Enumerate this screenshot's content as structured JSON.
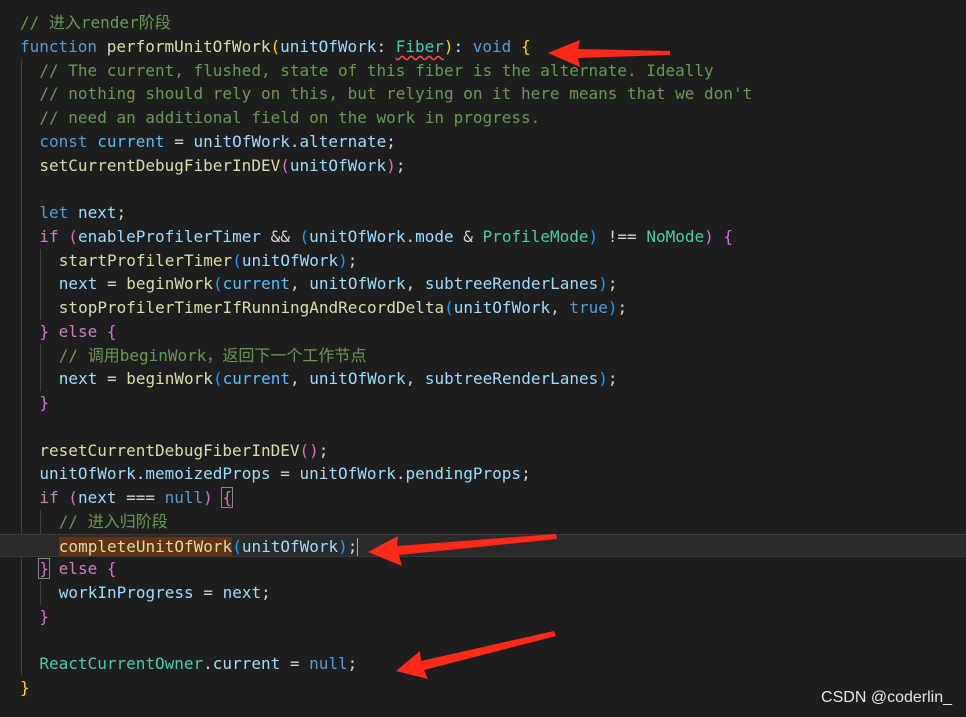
{
  "editor": {
    "lines": [
      {
        "indent": 0,
        "tokens": [
          {
            "t": "// 进入render阶段",
            "c": "com"
          }
        ]
      },
      {
        "indent": 0,
        "tokens": [
          {
            "t": "function",
            "c": "kw"
          },
          {
            "t": " ",
            "c": "pl"
          },
          {
            "t": "performUnitOfWork",
            "c": "fn"
          },
          {
            "t": "(",
            "c": "br1"
          },
          {
            "t": "unitOfWork",
            "c": "var"
          },
          {
            "t": ": ",
            "c": "pl"
          },
          {
            "t": "Fiber",
            "c": "ty",
            "squiggle": true
          },
          {
            "t": ")",
            "c": "br1"
          },
          {
            "t": ": ",
            "c": "pl"
          },
          {
            "t": "void",
            "c": "kw"
          },
          {
            "t": " ",
            "c": "pl"
          },
          {
            "t": "{",
            "c": "br1"
          }
        ]
      },
      {
        "indent": 1,
        "tokens": [
          {
            "t": "// The current, flushed, state of this fiber is the alternate. Ideally",
            "c": "com"
          }
        ]
      },
      {
        "indent": 1,
        "tokens": [
          {
            "t": "// nothing should rely on this, but relying on it here means that we don't",
            "c": "com"
          }
        ]
      },
      {
        "indent": 1,
        "tokens": [
          {
            "t": "// need an additional field on the work in progress.",
            "c": "com"
          }
        ]
      },
      {
        "indent": 1,
        "tokens": [
          {
            "t": "const",
            "c": "kw"
          },
          {
            "t": " ",
            "c": "pl"
          },
          {
            "t": "current",
            "c": "cst"
          },
          {
            "t": " = ",
            "c": "pl"
          },
          {
            "t": "unitOfWork",
            "c": "var"
          },
          {
            "t": ".",
            "c": "pl"
          },
          {
            "t": "alternate",
            "c": "var"
          },
          {
            "t": ";",
            "c": "pl"
          }
        ]
      },
      {
        "indent": 1,
        "tokens": [
          {
            "t": "setCurrentDebugFiberInDEV",
            "c": "fn"
          },
          {
            "t": "(",
            "c": "br2"
          },
          {
            "t": "unitOfWork",
            "c": "var"
          },
          {
            "t": ")",
            "c": "br2"
          },
          {
            "t": ";",
            "c": "pl"
          }
        ]
      },
      {
        "indent": 0,
        "tokens": []
      },
      {
        "indent": 1,
        "tokens": [
          {
            "t": "let",
            "c": "kw"
          },
          {
            "t": " ",
            "c": "pl"
          },
          {
            "t": "next",
            "c": "var"
          },
          {
            "t": ";",
            "c": "pl"
          }
        ]
      },
      {
        "indent": 1,
        "tokens": [
          {
            "t": "if",
            "c": "ctl"
          },
          {
            "t": " ",
            "c": "pl"
          },
          {
            "t": "(",
            "c": "br2"
          },
          {
            "t": "enableProfilerTimer",
            "c": "var"
          },
          {
            "t": " && ",
            "c": "pl"
          },
          {
            "t": "(",
            "c": "br3"
          },
          {
            "t": "unitOfWork",
            "c": "var"
          },
          {
            "t": ".",
            "c": "pl"
          },
          {
            "t": "mode",
            "c": "var"
          },
          {
            "t": " & ",
            "c": "pl"
          },
          {
            "t": "ProfileMode",
            "c": "ty"
          },
          {
            "t": ")",
            "c": "br3"
          },
          {
            "t": " !== ",
            "c": "pl"
          },
          {
            "t": "NoMode",
            "c": "ty"
          },
          {
            "t": ")",
            "c": "br2"
          },
          {
            "t": " ",
            "c": "pl"
          },
          {
            "t": "{",
            "c": "br2"
          }
        ]
      },
      {
        "indent": 2,
        "tokens": [
          {
            "t": "startProfilerTimer",
            "c": "fn"
          },
          {
            "t": "(",
            "c": "br3"
          },
          {
            "t": "unitOfWork",
            "c": "var"
          },
          {
            "t": ")",
            "c": "br3"
          },
          {
            "t": ";",
            "c": "pl"
          }
        ]
      },
      {
        "indent": 2,
        "tokens": [
          {
            "t": "next",
            "c": "var"
          },
          {
            "t": " = ",
            "c": "pl"
          },
          {
            "t": "beginWork",
            "c": "fn"
          },
          {
            "t": "(",
            "c": "br3"
          },
          {
            "t": "current",
            "c": "cst"
          },
          {
            "t": ", ",
            "c": "pl"
          },
          {
            "t": "unitOfWork",
            "c": "var"
          },
          {
            "t": ", ",
            "c": "pl"
          },
          {
            "t": "subtreeRenderLanes",
            "c": "var"
          },
          {
            "t": ")",
            "c": "br3"
          },
          {
            "t": ";",
            "c": "pl"
          }
        ]
      },
      {
        "indent": 2,
        "tokens": [
          {
            "t": "stopProfilerTimerIfRunningAndRecordDelta",
            "c": "fn"
          },
          {
            "t": "(",
            "c": "br3"
          },
          {
            "t": "unitOfWork",
            "c": "var"
          },
          {
            "t": ", ",
            "c": "pl"
          },
          {
            "t": "true",
            "c": "kw"
          },
          {
            "t": ")",
            "c": "br3"
          },
          {
            "t": ";",
            "c": "pl"
          }
        ]
      },
      {
        "indent": 1,
        "tokens": [
          {
            "t": "}",
            "c": "br2"
          },
          {
            "t": " ",
            "c": "pl"
          },
          {
            "t": "else",
            "c": "ctl"
          },
          {
            "t": " ",
            "c": "pl"
          },
          {
            "t": "{",
            "c": "br2"
          }
        ]
      },
      {
        "indent": 2,
        "tokens": [
          {
            "t": "// 调用beginWork，返回下一个工作节点",
            "c": "com"
          }
        ]
      },
      {
        "indent": 2,
        "tokens": [
          {
            "t": "next",
            "c": "var"
          },
          {
            "t": " = ",
            "c": "pl"
          },
          {
            "t": "beginWork",
            "c": "fn"
          },
          {
            "t": "(",
            "c": "br3"
          },
          {
            "t": "current",
            "c": "cst"
          },
          {
            "t": ", ",
            "c": "pl"
          },
          {
            "t": "unitOfWork",
            "c": "var"
          },
          {
            "t": ", ",
            "c": "pl"
          },
          {
            "t": "subtreeRenderLanes",
            "c": "var"
          },
          {
            "t": ")",
            "c": "br3"
          },
          {
            "t": ";",
            "c": "pl"
          }
        ]
      },
      {
        "indent": 1,
        "tokens": [
          {
            "t": "}",
            "c": "br2"
          }
        ]
      },
      {
        "indent": 0,
        "tokens": []
      },
      {
        "indent": 1,
        "tokens": [
          {
            "t": "resetCurrentDebugFiberInDEV",
            "c": "fn"
          },
          {
            "t": "(",
            "c": "br2"
          },
          {
            "t": ")",
            "c": "br2"
          },
          {
            "t": ";",
            "c": "pl"
          }
        ]
      },
      {
        "indent": 1,
        "tokens": [
          {
            "t": "unitOfWork",
            "c": "var"
          },
          {
            "t": ".",
            "c": "pl"
          },
          {
            "t": "memoizedProps",
            "c": "var"
          },
          {
            "t": " = ",
            "c": "pl"
          },
          {
            "t": "unitOfWork",
            "c": "var"
          },
          {
            "t": ".",
            "c": "pl"
          },
          {
            "t": "pendingProps",
            "c": "var"
          },
          {
            "t": ";",
            "c": "pl"
          }
        ]
      },
      {
        "indent": 1,
        "tokens": [
          {
            "t": "if",
            "c": "ctl"
          },
          {
            "t": " ",
            "c": "pl"
          },
          {
            "t": "(",
            "c": "br2"
          },
          {
            "t": "next",
            "c": "var"
          },
          {
            "t": " === ",
            "c": "pl"
          },
          {
            "t": "null",
            "c": "kw"
          },
          {
            "t": ")",
            "c": "br2"
          },
          {
            "t": " ",
            "c": "pl"
          },
          {
            "t": "{",
            "c": "br2",
            "box": true
          }
        ]
      },
      {
        "indent": 2,
        "tokens": [
          {
            "t": "// 进入归阶段",
            "c": "com"
          }
        ]
      },
      {
        "indent": 2,
        "active": true,
        "tokens": [
          {
            "t": "completeUnitOfWork",
            "c": "fn",
            "hl": true
          },
          {
            "t": "(",
            "c": "br3"
          },
          {
            "t": "unitOfWork",
            "c": "var"
          },
          {
            "t": ")",
            "c": "br3"
          },
          {
            "t": ";",
            "c": "pl"
          },
          {
            "caret": true
          }
        ]
      },
      {
        "indent": 1,
        "tokens": [
          {
            "t": "}",
            "c": "br2",
            "box": true
          },
          {
            "t": " ",
            "c": "pl"
          },
          {
            "t": "else",
            "c": "ctl"
          },
          {
            "t": " ",
            "c": "pl"
          },
          {
            "t": "{",
            "c": "br2"
          }
        ]
      },
      {
        "indent": 2,
        "tokens": [
          {
            "t": "workInProgress",
            "c": "var"
          },
          {
            "t": " = ",
            "c": "pl"
          },
          {
            "t": "next",
            "c": "var"
          },
          {
            "t": ";",
            "c": "pl"
          }
        ]
      },
      {
        "indent": 1,
        "tokens": [
          {
            "t": "}",
            "c": "br2"
          }
        ]
      },
      {
        "indent": 0,
        "tokens": []
      },
      {
        "indent": 1,
        "tokens": [
          {
            "t": "ReactCurrentOwner",
            "c": "ty"
          },
          {
            "t": ".",
            "c": "pl"
          },
          {
            "t": "current",
            "c": "var"
          },
          {
            "t": " = ",
            "c": "pl"
          },
          {
            "t": "null",
            "c": "kw"
          },
          {
            "t": ";",
            "c": "pl"
          }
        ]
      },
      {
        "indent": 0,
        "tokens": [
          {
            "t": "}",
            "c": "br1"
          }
        ]
      }
    ]
  },
  "annotations": {
    "arrow_color": "#ff2a1a",
    "arrows": [
      "arrow-function-signature",
      "arrow-complete-unit-of-work",
      "arrow-react-current-owner"
    ]
  },
  "watermark": {
    "text": "CSDN @coderlin_"
  }
}
